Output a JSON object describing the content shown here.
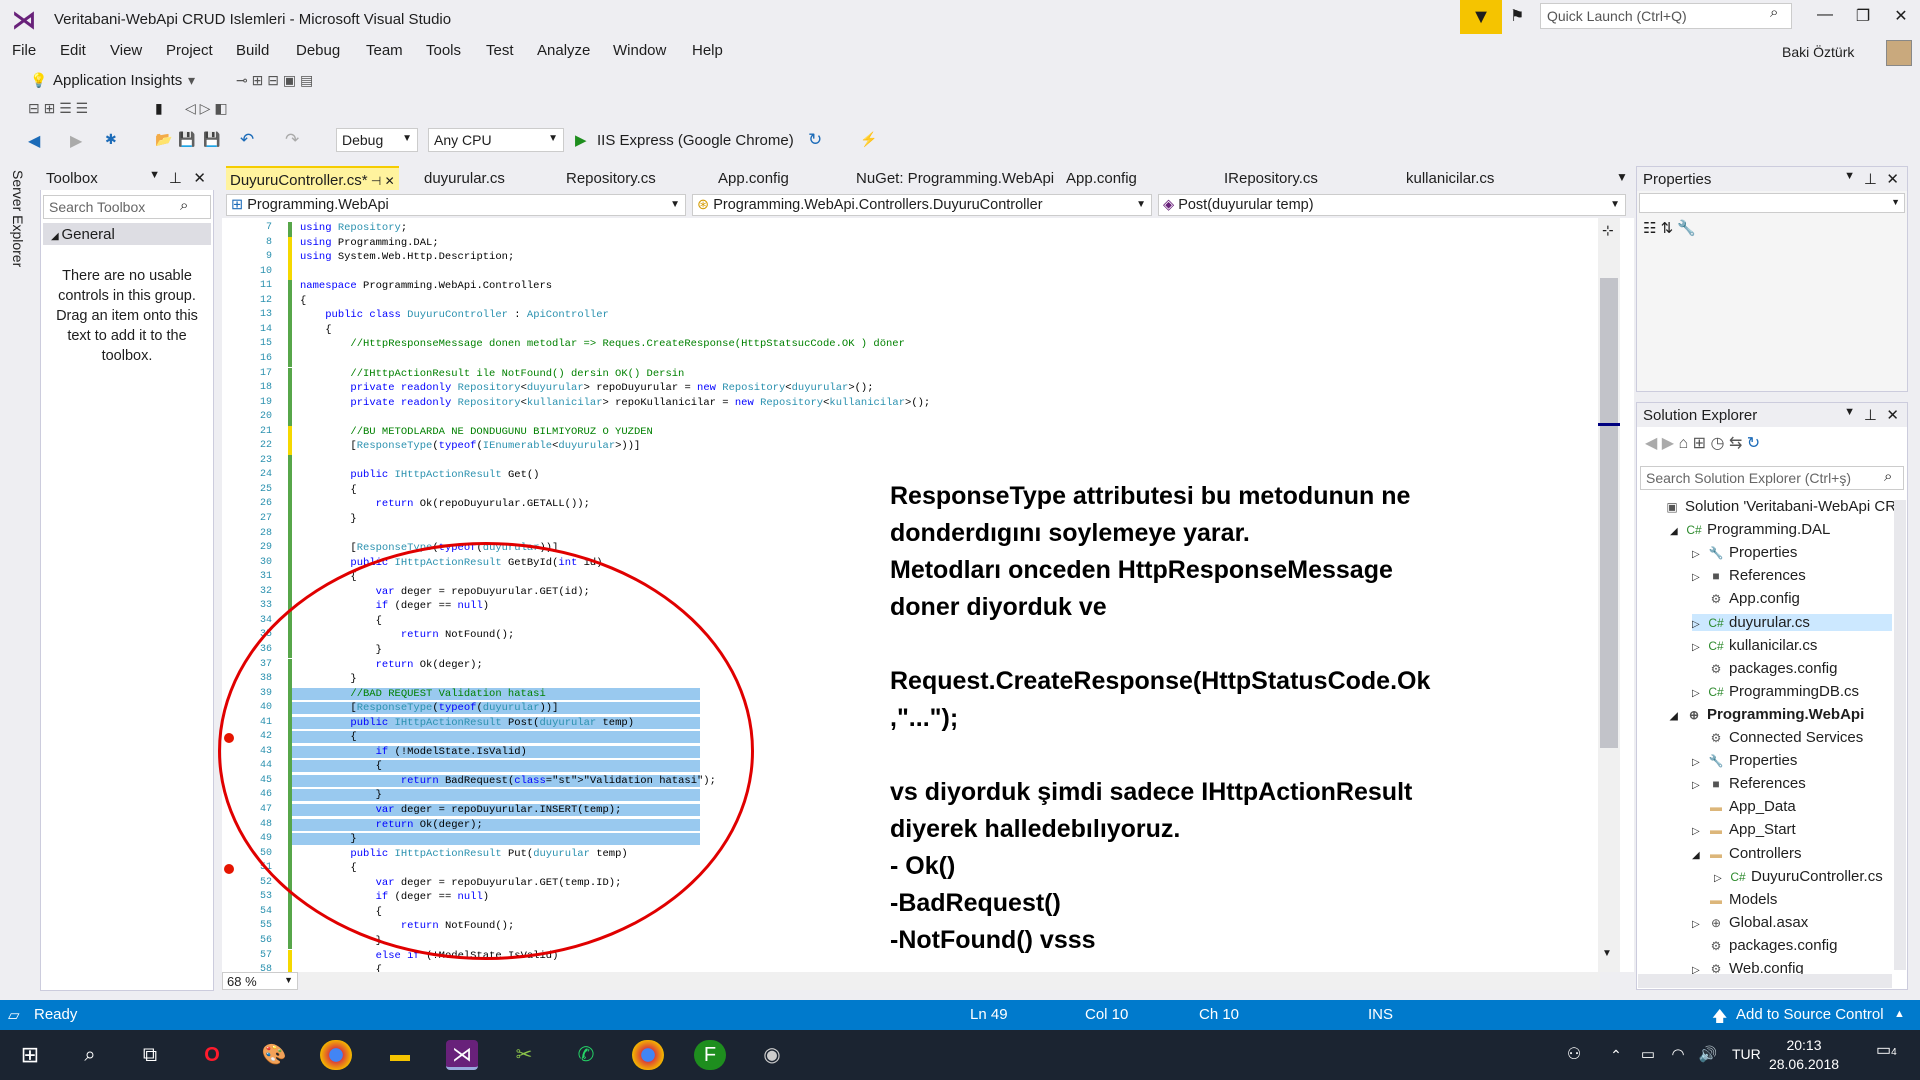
{
  "window": {
    "title": "Veritabani-WebApi CRUD Islemleri - Microsoft Visual Studio",
    "quick_launch": "Quick Launch (Ctrl+Q)",
    "user": "Baki Öztürk"
  },
  "menu": [
    "File",
    "Edit",
    "View",
    "Project",
    "Build",
    "Debug",
    "Team",
    "Tools",
    "Test",
    "Analyze",
    "Window",
    "Help"
  ],
  "toolbar": {
    "app_insights": "Application Insights",
    "config": "Debug",
    "platform": "Any CPU",
    "run": "IIS Express (Google Chrome)"
  },
  "server_explorer": "Server Explorer",
  "toolbox": {
    "title": "Toolbox",
    "search_placeholder": "Search Toolbox",
    "group": "General",
    "message": "There are no usable controls in this group. Drag an item onto this text to add it to the toolbox."
  },
  "tabs": [
    "DuyuruController.cs*",
    "duyurular.cs",
    "Repository.cs",
    "App.config",
    "NuGet: Programming.WebApi",
    "App.config",
    "IRepository.cs",
    "kullanicilar.cs"
  ],
  "nav": {
    "project": "Programming.WebApi",
    "class": "Programming.WebApi.Controllers.DuyuruController",
    "member": "Post(duyurular temp)"
  },
  "code": [
    {
      "n": "7",
      "t": "using Repository;"
    },
    {
      "n": "8",
      "t": "using Programming.DAL;"
    },
    {
      "n": "9",
      "t": "using System.Web.Http.Description;"
    },
    {
      "n": "10",
      "t": ""
    },
    {
      "n": "11",
      "t": "namespace Programming.WebApi.Controllers"
    },
    {
      "n": "12",
      "t": "{"
    },
    {
      "n": "13",
      "t": "    public class DuyuruController : ApiController"
    },
    {
      "n": "14",
      "t": "    {"
    },
    {
      "n": "15",
      "t": "        //HttpResponseMessage donen metodlar => Reques.CreateResponse(HttpStatsucCode.OK ) döner"
    },
    {
      "n": "16",
      "t": ""
    },
    {
      "n": "17",
      "t": "        //IHttpActionResult ile NotFound() dersin OK() Dersin"
    },
    {
      "n": "18",
      "t": "        private readonly Repository<duyurular> repoDuyurular = new Repository<duyurular>();"
    },
    {
      "n": "19",
      "t": "        private readonly Repository<kullanicilar> repoKullanicilar = new Repository<kullanicilar>();"
    },
    {
      "n": "20",
      "t": ""
    },
    {
      "n": "21",
      "t": "        //BU METODLARDA NE DONDUGUNU BILMIYORUZ O YUZDEN"
    },
    {
      "n": "22",
      "t": "        [ResponseType(typeof(IEnumerable<duyurular>))]"
    },
    {
      "n": "23",
      "t": ""
    },
    {
      "n": "24",
      "t": "        public IHttpActionResult Get()"
    },
    {
      "n": "25",
      "t": "        {"
    },
    {
      "n": "26",
      "t": "            return Ok(repoDuyurular.GETALL());"
    },
    {
      "n": "27",
      "t": "        }"
    },
    {
      "n": "28",
      "t": ""
    },
    {
      "n": "29",
      "t": "        [ResponseType(typeof(duyurular))]"
    },
    {
      "n": "30",
      "t": "        public IHttpActionResult GetById(int id)"
    },
    {
      "n": "31",
      "t": "        {"
    },
    {
      "n": "32",
      "t": "            var deger = repoDuyurular.GET(id);"
    },
    {
      "n": "33",
      "t": "            if (deger == null)"
    },
    {
      "n": "34",
      "t": "            {"
    },
    {
      "n": "35",
      "t": "                return NotFound();"
    },
    {
      "n": "36",
      "t": "            }"
    },
    {
      "n": "37",
      "t": "            return Ok(deger);"
    },
    {
      "n": "38",
      "t": "        }"
    },
    {
      "n": "39",
      "t": "        //BAD REQUEST Validation hatasi"
    },
    {
      "n": "40",
      "t": "        [ResponseType(typeof(duyurular))]"
    },
    {
      "n": "41",
      "t": "        public IHttpActionResult Post(duyurular temp)"
    },
    {
      "n": "42",
      "t": "        {"
    },
    {
      "n": "43",
      "t": "            if (!ModelState.IsValid)"
    },
    {
      "n": "44",
      "t": "            {"
    },
    {
      "n": "45",
      "t": "                return BadRequest(\"Validation hatasi\");"
    },
    {
      "n": "46",
      "t": "            }"
    },
    {
      "n": "47",
      "t": "            var deger = repoDuyurular.INSERT(temp);"
    },
    {
      "n": "48",
      "t": "            return Ok(deger);"
    },
    {
      "n": "49",
      "t": "        }"
    },
    {
      "n": "50",
      "t": "        public IHttpActionResult Put(duyurular temp)"
    },
    {
      "n": "51",
      "t": "        {"
    },
    {
      "n": "52",
      "t": "            var deger = repoDuyurular.GET(temp.ID);"
    },
    {
      "n": "53",
      "t": "            if (deger == null)"
    },
    {
      "n": "54",
      "t": "            {"
    },
    {
      "n": "55",
      "t": "                return NotFound();"
    },
    {
      "n": "56",
      "t": "            }"
    },
    {
      "n": "57",
      "t": "            else if (!ModelState.IsValid)"
    },
    {
      "n": "58",
      "t": "            {"
    }
  ],
  "zoom": "68 %",
  "annotation": [
    "ResponseType attributesi bu metodunun ne",
    "donderdıgını soylemeye yarar.",
    "Metodları onceden HttpResponseMessage",
    "doner diyorduk ve",
    "",
    "Request.CreateResponse(HttpStatusCode.Ok",
    ",\"...\");",
    "",
    "vs diyorduk şimdi sadece IHttpActionResult",
    "diyerek halledebılıyoruz.",
    "- Ok()",
    "-BadRequest()",
    "-NotFound() vsss"
  ],
  "properties": {
    "title": "Properties"
  },
  "solution_explorer": {
    "title": "Solution Explorer",
    "search_placeholder": "Search Solution Explorer (Ctrl+ş)",
    "items": [
      {
        "label": "Solution 'Veritabani-WebApi CRU",
        "indent": 0,
        "icon": "▣",
        "exp": ""
      },
      {
        "label": "Programming.DAL",
        "indent": 1,
        "icon": "C#",
        "exp": "◢"
      },
      {
        "label": "Properties",
        "indent": 2,
        "icon": "🔧",
        "exp": "▷"
      },
      {
        "label": "References",
        "indent": 2,
        "icon": "■",
        "exp": "▷"
      },
      {
        "label": "App.config",
        "indent": 2,
        "icon": "⚙",
        "exp": ""
      },
      {
        "label": "duyurular.cs",
        "indent": 2,
        "icon": "C#",
        "exp": "▷"
      },
      {
        "label": "kullanicilar.cs",
        "indent": 2,
        "icon": "C#",
        "exp": "▷"
      },
      {
        "label": "packages.config",
        "indent": 2,
        "icon": "⚙",
        "exp": ""
      },
      {
        "label": "ProgrammingDB.cs",
        "indent": 2,
        "icon": "C#",
        "exp": "▷"
      },
      {
        "label": "Programming.WebApi",
        "indent": 1,
        "icon": "⊕",
        "exp": "◢"
      },
      {
        "label": "Connected Services",
        "indent": 2,
        "icon": "⚙",
        "exp": ""
      },
      {
        "label": "Properties",
        "indent": 2,
        "icon": "🔧",
        "exp": "▷"
      },
      {
        "label": "References",
        "indent": 2,
        "icon": "■",
        "exp": "▷"
      },
      {
        "label": "App_Data",
        "indent": 2,
        "icon": "▬",
        "exp": ""
      },
      {
        "label": "App_Start",
        "indent": 2,
        "icon": "▬",
        "exp": "▷"
      },
      {
        "label": "Controllers",
        "indent": 2,
        "icon": "▬",
        "exp": "◢"
      },
      {
        "label": "DuyuruController.cs",
        "indent": 3,
        "icon": "C#",
        "exp": "▷"
      },
      {
        "label": "Models",
        "indent": 2,
        "icon": "▬",
        "exp": ""
      },
      {
        "label": "Global.asax",
        "indent": 2,
        "icon": "⊕",
        "exp": "▷"
      },
      {
        "label": "packages.config",
        "indent": 2,
        "icon": "⚙",
        "exp": ""
      },
      {
        "label": "Web.config",
        "indent": 2,
        "icon": "⚙",
        "exp": "▷"
      }
    ]
  },
  "status": {
    "ready": "Ready",
    "ln": "Ln 49",
    "col": "Col 10",
    "ch": "Ch 10",
    "ins": "INS",
    "source_control": "Add to Source Control"
  },
  "taskbar": {
    "lang": "TUR",
    "time": "20:13",
    "date": "28.06.2018",
    "notif_count": "4"
  },
  "colors": {
    "accent": "#007acc",
    "active_tab": "#fff39e",
    "ellipse": "#e00000",
    "taskbar": "#1b2431"
  }
}
